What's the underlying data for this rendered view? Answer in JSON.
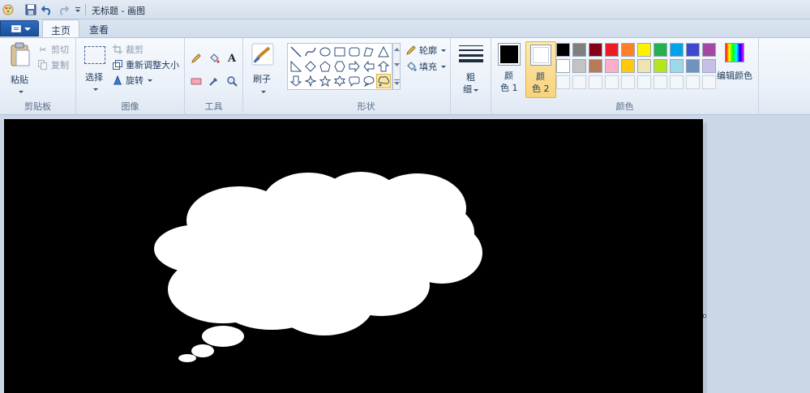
{
  "window": {
    "title": "无标题 - 画图"
  },
  "tabs": [
    {
      "label": "主页"
    },
    {
      "label": "查看"
    }
  ],
  "clipboard": {
    "paste": "粘贴",
    "cut": "剪切",
    "copy": "复制",
    "group": "剪贴板"
  },
  "image": {
    "select": "选择",
    "crop": "裁剪",
    "resize": "重新调整大小",
    "rotate": "旋转",
    "group": "图像"
  },
  "tools": {
    "group": "工具"
  },
  "brushes": {
    "label": "刷子"
  },
  "shapes": {
    "outline": "轮廓",
    "fill": "填充",
    "group": "形状"
  },
  "size": {
    "line1": "粗",
    "line2": "细"
  },
  "colors": {
    "color1_line1": "颜",
    "color1_line2": "色 1",
    "color2_line1": "颜",
    "color2_line2": "色 2",
    "edit": "编辑颜色",
    "group": "颜色",
    "color1_value": "#000000",
    "color2_value": "#ffffff",
    "palette_row1": [
      "#000000",
      "#7f7f7f",
      "#880015",
      "#ed1c24",
      "#ff7f27",
      "#fff200",
      "#22b14c",
      "#00a2e8",
      "#3f48cc",
      "#a349a4"
    ],
    "palette_row2": [
      "#ffffff",
      "#c3c3c3",
      "#b97a57",
      "#ffaec9",
      "#ffc90e",
      "#efe4b0",
      "#b5e61d",
      "#99d9ea",
      "#7092be",
      "#c8bfe7"
    ]
  }
}
